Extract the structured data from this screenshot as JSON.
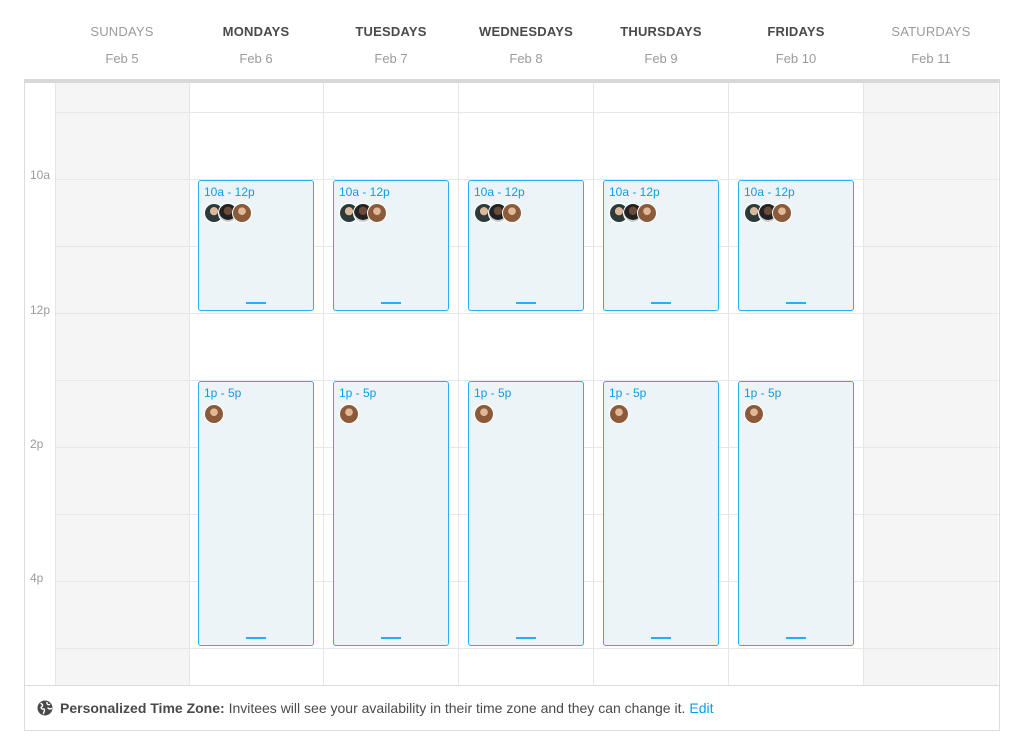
{
  "days": [
    {
      "name": "SUNDAYS",
      "date": "Feb 5",
      "active": false
    },
    {
      "name": "MONDAYS",
      "date": "Feb 6",
      "active": true
    },
    {
      "name": "TUESDAYS",
      "date": "Feb 7",
      "active": true
    },
    {
      "name": "WEDNESDAYS",
      "date": "Feb 8",
      "active": true
    },
    {
      "name": "THURSDAYS",
      "date": "Feb 9",
      "active": true
    },
    {
      "name": "FRIDAYS",
      "date": "Feb 10",
      "active": true
    },
    {
      "name": "SATURDAYS",
      "date": "Feb 11",
      "active": false
    }
  ],
  "time_labels": [
    "10a",
    "12p",
    "2p",
    "4p"
  ],
  "blocks": {
    "morning": {
      "range": "10a - 12p",
      "avatars": [
        "a1",
        "a2",
        "a3"
      ]
    },
    "afternoon": {
      "range": "1p - 5p",
      "avatars": [
        "a3"
      ]
    }
  },
  "footer": {
    "icon": "globe-icon",
    "label": "Personalized Time Zone:",
    "text": "Invitees will see your availability in their time zone and they can change it.",
    "edit": "Edit"
  },
  "colors": {
    "accent": "#0a9ce6",
    "block_bg": "#edf4f8",
    "border": "#29aef2",
    "off_day_bg": "#f5f5f5"
  }
}
